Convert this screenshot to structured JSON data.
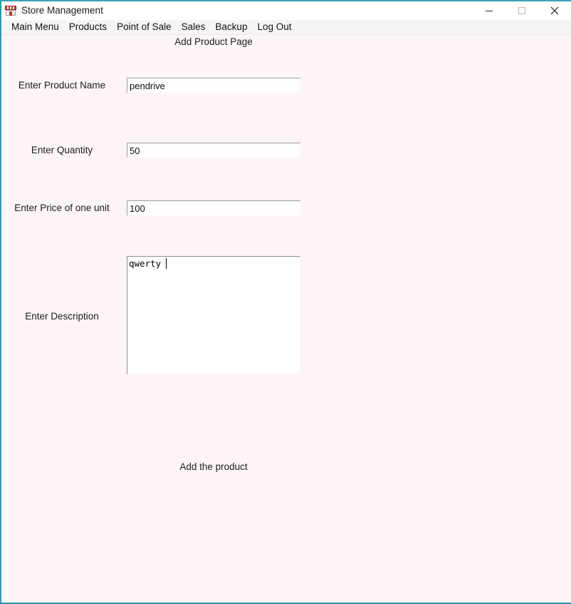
{
  "window": {
    "title": "Store Management",
    "icon": "store-icon",
    "border_color": "#2e9aaa",
    "background_color": "#fdf5f5",
    "controls": [
      {
        "name": "minimize",
        "glyph": "—"
      },
      {
        "name": "maximize",
        "glyph": "□"
      },
      {
        "name": "close",
        "glyph": "✕"
      }
    ]
  },
  "menubar": {
    "items": [
      {
        "label": "Main Menu"
      },
      {
        "label": "Products"
      },
      {
        "label": "Point of Sale"
      },
      {
        "label": "Sales"
      },
      {
        "label": "Backup"
      },
      {
        "label": "Log Out"
      }
    ]
  },
  "page": {
    "title": "Add Product Page",
    "fields": [
      {
        "label": "Enter Product Name",
        "value": "pendrive",
        "placeholder": "",
        "type": "text"
      },
      {
        "label": "Enter Quantity",
        "value": "50",
        "placeholder": "",
        "type": "text"
      },
      {
        "label": "Enter Price of one unit",
        "value": "100",
        "placeholder": "",
        "type": "text"
      },
      {
        "label": "Enter Description",
        "value": "qwerty",
        "placeholder": "",
        "type": "textarea"
      }
    ],
    "submit_label": "Add the product"
  }
}
